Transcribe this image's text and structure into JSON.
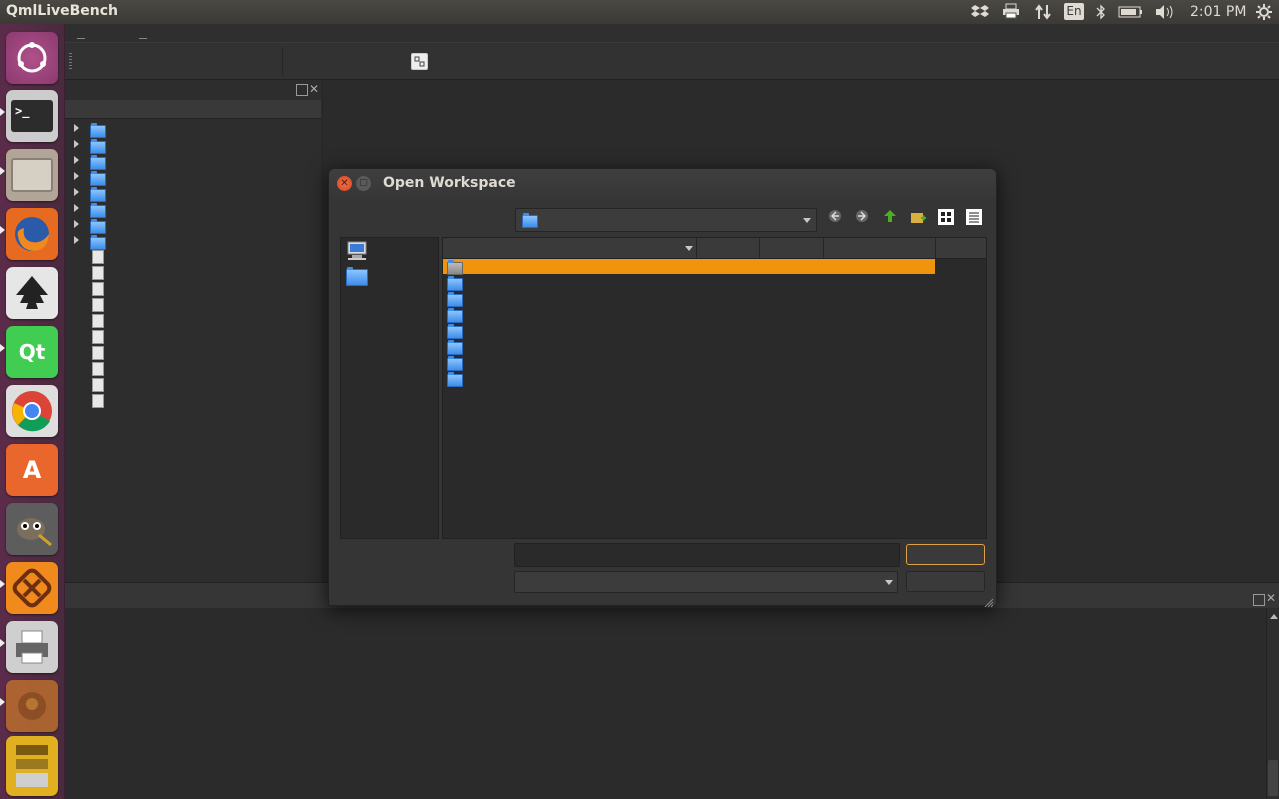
{
  "top_panel": {
    "app_title": "QmlLiveBench",
    "keyboard_layout": "En",
    "clock": "2:01 PM",
    "tray_icons": [
      "dropbox-icon",
      "printer-icon",
      "network-icon",
      "keyboard-icon",
      "bluetooth-icon",
      "battery-icon",
      "volume-icon",
      "gear-icon"
    ]
  },
  "launcher": {
    "items": [
      "ubuntu-dash",
      "terminal",
      "files",
      "firefox",
      "inkscape",
      "qt-creator",
      "chrome",
      "software-center",
      "gimp",
      "xampp",
      "printer",
      "unknown-app",
      "stack-app"
    ],
    "qt_label": "Qt"
  },
  "dialog": {
    "title": "Open Workspace",
    "look_in_value": "",
    "file_name_value": "",
    "file_type_value": "",
    "ok_label": "",
    "cancel_label": "",
    "sidebar_places": [
      "computer",
      "home-folder"
    ],
    "rows_count": 8
  },
  "colors": {
    "selection": "#f0940e",
    "close_button": "#e5562a",
    "accent_focus": "#e2a045"
  }
}
